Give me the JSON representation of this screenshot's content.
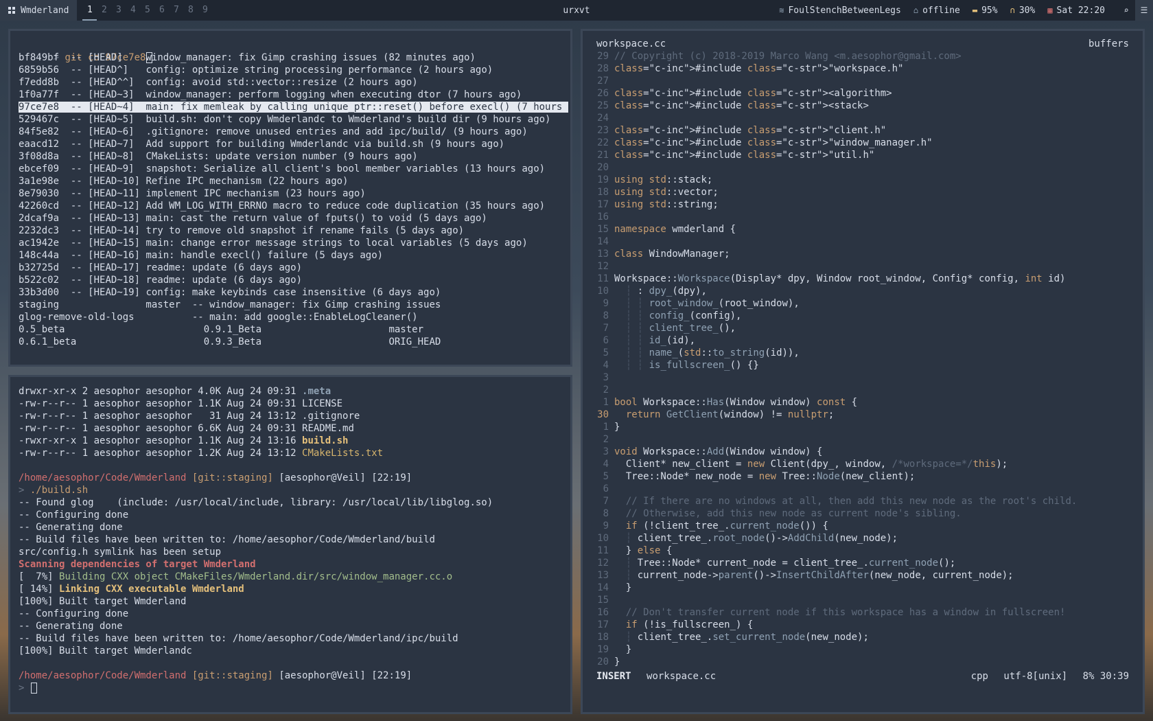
{
  "topbar": {
    "app_label": "Wmderland",
    "workspaces": [
      "1",
      "2",
      "3",
      "4",
      "5",
      "6",
      "7",
      "8",
      "9"
    ],
    "active_workspace": "1",
    "window_title": "urxvt",
    "wifi": "FoulStenchBetweenLegs",
    "network_status": "offline",
    "battery": "95%",
    "volume": "30%",
    "datetime": "Sat 22:20"
  },
  "git_log": {
    "command": "git co 97ce7e8",
    "prompt_symbol": ">",
    "entries": [
      {
        "hash": "bf849bf",
        "ref": "[HEAD]   ",
        "msg": "window_manager: fix Gimp crashing issues (82 minutes ago)"
      },
      {
        "hash": "6859b56",
        "ref": "[HEAD^]  ",
        "msg": "config: optimize string processing performance (2 hours ago)"
      },
      {
        "hash": "f7edd8b",
        "ref": "[HEAD^^] ",
        "msg": "config: avoid std::vector::resize (2 hours ago)"
      },
      {
        "hash": "1f0a77f",
        "ref": "[HEAD~3] ",
        "msg": "window_manager: perform logging when executing dtor (7 hours ago)"
      },
      {
        "hash": "97ce7e8",
        "ref": "[HEAD~4] ",
        "msg": "main: fix memleak by calling unique_ptr::reset() before execl() (7 hours "
      },
      {
        "hash": "529467c",
        "ref": "[HEAD~5] ",
        "msg": "build.sh: don't copy Wmderlandc to Wmderland's build dir (9 hours ago)"
      },
      {
        "hash": "84f5e82",
        "ref": "[HEAD~6] ",
        "msg": ".gitignore: remove unused entries and add ipc/build/ (9 hours ago)"
      },
      {
        "hash": "eaacd12",
        "ref": "[HEAD~7] ",
        "msg": "Add support for building Wmderlandc via build.sh (9 hours ago)"
      },
      {
        "hash": "3f08d8a",
        "ref": "[HEAD~8] ",
        "msg": "CMakeLists: update version number (9 hours ago)"
      },
      {
        "hash": "ebcef09",
        "ref": "[HEAD~9] ",
        "msg": "snapshot: Serialize all client's bool member variables (13 hours ago)"
      },
      {
        "hash": "3a1e98e",
        "ref": "[HEAD~10]",
        "msg": "Refine IPC mechanism (22 hours ago)"
      },
      {
        "hash": "8e79030",
        "ref": "[HEAD~11]",
        "msg": "implement IPC mechanism (23 hours ago)"
      },
      {
        "hash": "42260cd",
        "ref": "[HEAD~12]",
        "msg": "Add WM_LOG_WITH_ERRNO macro to reduce code duplication (35 hours ago)"
      },
      {
        "hash": "2dcaf9a",
        "ref": "[HEAD~13]",
        "msg": "main: cast the return value of fputs() to void (5 days ago)"
      },
      {
        "hash": "2232dc3",
        "ref": "[HEAD~14]",
        "msg": "try to remove old snapshot if rename fails (5 days ago)"
      },
      {
        "hash": "ac1942e",
        "ref": "[HEAD~15]",
        "msg": "main: change error message strings to local variables (5 days ago)"
      },
      {
        "hash": "148c44a",
        "ref": "[HEAD~16]",
        "msg": "main: handle execl() failure (5 days ago)"
      },
      {
        "hash": "b32725d",
        "ref": "[HEAD~17]",
        "msg": "readme: update (6 days ago)"
      },
      {
        "hash": "b522c02",
        "ref": "[HEAD~18]",
        "msg": "readme: update (6 days ago)"
      },
      {
        "hash": "33b3d00",
        "ref": "[HEAD~19]",
        "msg": "config: make keybinds case insensitive (6 days ago)"
      }
    ],
    "selected_index": 4,
    "branches": [
      "staging               master  -- window_manager: fix Gimp crashing issues",
      "glog-remove-old-logs          -- main: add google::EnableLogCleaner()",
      "0.5_beta                        0.9.1_Beta                      master",
      "0.6.1_beta                      0.9.3_Beta                      ORIG_HEAD"
    ]
  },
  "shell": {
    "listing": [
      {
        "perm": "drwxr-xr-x 2 aesophor aesophor 4.0K Aug 24 09:31 ",
        "name": ".meta",
        "style": "dir"
      },
      {
        "perm": "-rw-r--r-- 1 aesophor aesophor 1.1K Aug 24 09:31 ",
        "name": "LICENSE",
        "style": "plain"
      },
      {
        "perm": "-rw-r--r-- 1 aesophor aesophor   31 Aug 24 13:12 ",
        "name": ".gitignore",
        "style": "plain"
      },
      {
        "perm": "-rw-r--r-- 1 aesophor aesophor 6.6K Aug 24 09:31 ",
        "name": "README.md",
        "style": "plain"
      },
      {
        "perm": "-rwxr-xr-x 1 aesophor aesophor 1.1K Aug 24 13:16 ",
        "name": "build.sh",
        "style": "exec"
      },
      {
        "perm": "-rw-r--r-- 1 aesophor aesophor 1.2K Aug 24 13:12 ",
        "name": "CMakeLists.txt",
        "style": "cmake"
      }
    ],
    "prompt_path": "/home/aesophor/Code/Wmderland",
    "prompt_git": "[git::staging]",
    "prompt_user": "[aesophor@Veil]",
    "prompt_time_1": "[22:19]",
    "prompt_time_2": "[22:19]",
    "command": "./build.sh",
    "prompt_symbol": ">",
    "output": [
      {
        "text": "-- Found glog    (include: /usr/local/include, library: /usr/local/lib/libglog.so)",
        "style": "plain"
      },
      {
        "text": "-- Configuring done",
        "style": "plain"
      },
      {
        "text": "-- Generating done",
        "style": "plain"
      },
      {
        "text": "-- Build files have been written to: /home/aesophor/Code/Wmderland/build",
        "style": "plain"
      },
      {
        "text": "src/config.h symlink has been setup",
        "style": "plain"
      },
      {
        "text": "Scanning dependencies of target Wmderland",
        "style": "scan"
      },
      {
        "prefix": "[  7%] ",
        "text": "Building CXX object CMakeFiles/Wmderland.dir/src/window_manager.cc.o",
        "style": "build"
      },
      {
        "prefix": "[ 14%] ",
        "text": "Linking CXX executable Wmderland",
        "style": "link"
      },
      {
        "text": "[100%] Built target Wmderland",
        "style": "plain"
      },
      {
        "text": "-- Configuring done",
        "style": "plain"
      },
      {
        "text": "-- Generating done",
        "style": "plain"
      },
      {
        "text": "-- Build files have been written to: /home/aesophor/Code/Wmderland/ipc/build",
        "style": "plain"
      },
      {
        "text": "[100%] Built target Wmderlandc",
        "style": "plain"
      }
    ]
  },
  "editor": {
    "filename": "workspace.cc",
    "buffers_label": "buffers",
    "lines": [
      {
        "n": "29",
        "code": "// Copyright (c) 2018-2019 Marco Wang <m.aesophor@gmail.com>",
        "style": "cmt"
      },
      {
        "n": "28",
        "code": "#include \"workspace.h\"",
        "style": "inc"
      },
      {
        "n": "27",
        "code": "",
        "style": "plain"
      },
      {
        "n": "26",
        "code": "#include <algorithm>",
        "style": "inc"
      },
      {
        "n": "25",
        "code": "#include <stack>",
        "style": "inc"
      },
      {
        "n": "24",
        "code": "",
        "style": "plain"
      },
      {
        "n": "23",
        "code": "#include \"client.h\"",
        "style": "inc"
      },
      {
        "n": "22",
        "code": "#include \"window_manager.h\"",
        "style": "inc"
      },
      {
        "n": "21",
        "code": "#include \"util.h\"",
        "style": "inc"
      },
      {
        "n": "20",
        "code": "",
        "style": "plain"
      },
      {
        "n": "19",
        "code": "using std::stack;",
        "style": "using"
      },
      {
        "n": "18",
        "code": "using std::vector;",
        "style": "using"
      },
      {
        "n": "17",
        "code": "using std::string;",
        "style": "using"
      },
      {
        "n": "16",
        "code": "",
        "style": "plain"
      },
      {
        "n": "15",
        "code": "namespace wmderland {",
        "style": "ns"
      },
      {
        "n": "14",
        "code": "",
        "style": "plain"
      },
      {
        "n": "13",
        "code": "class WindowManager;",
        "style": "class"
      },
      {
        "n": "12",
        "code": "",
        "style": "plain"
      },
      {
        "n": "11",
        "code": "Workspace::Workspace(Display* dpy, Window root_window, Config* config, int id)",
        "style": "ctor"
      },
      {
        "n": "10",
        "code": "  ┆ : dpy_(dpy),",
        "style": "init"
      },
      {
        "n": "9",
        "code": "  ┆ ┆ root_window_(root_window),",
        "style": "init"
      },
      {
        "n": "8",
        "code": "  ┆ ┆ config_(config),",
        "style": "init"
      },
      {
        "n": "7",
        "code": "  ┆ ┆ client_tree_(),",
        "style": "init"
      },
      {
        "n": "6",
        "code": "  ┆ ┆ id_(id),",
        "style": "init"
      },
      {
        "n": "5",
        "code": "  ┆ ┆ name_(std::to_string(id)),",
        "style": "init"
      },
      {
        "n": "4",
        "code": "  ┆ ┆ is_fullscreen_() {}",
        "style": "init"
      },
      {
        "n": "3",
        "code": "",
        "style": "plain"
      },
      {
        "n": "2",
        "code": "",
        "style": "plain"
      },
      {
        "n": "1",
        "code": "bool Workspace::Has(Window window) const {",
        "style": "fnbool"
      },
      {
        "n": "30",
        "code": "  return GetClient(window) != nullptr;",
        "style": "ret",
        "current": true
      },
      {
        "n": "1",
        "code": "}",
        "style": "plain"
      },
      {
        "n": "2",
        "code": "",
        "style": "plain"
      },
      {
        "n": "3",
        "code": "void Workspace::Add(Window window) {",
        "style": "fnvoid"
      },
      {
        "n": "4",
        "code": "  Client* new_client = new Client(dpy_, window, /*workspace=*/this);",
        "style": "newc"
      },
      {
        "n": "5",
        "code": "  Tree::Node* new_node = new Tree::Node(new_client);",
        "style": "newn"
      },
      {
        "n": "6",
        "code": "",
        "style": "plain"
      },
      {
        "n": "7",
        "code": "  // If there are no windows at all, then add this new node as the root's child.",
        "style": "cmt"
      },
      {
        "n": "8",
        "code": "  // Otherwise, add this new node as current node's sibling.",
        "style": "cmt"
      },
      {
        "n": "9",
        "code": "  if (!client_tree_.current_node()) {",
        "style": "if1"
      },
      {
        "n": "10",
        "code": "  ┆ client_tree_.root_node()->AddChild(new_node);",
        "style": "stmt1"
      },
      {
        "n": "11",
        "code": "  } else {",
        "style": "else"
      },
      {
        "n": "12",
        "code": "  ┆ Tree::Node* current_node = client_tree_.current_node();",
        "style": "stmt2"
      },
      {
        "n": "13",
        "code": "  ┆ current_node->parent()->InsertChildAfter(new_node, current_node);",
        "style": "stmt3"
      },
      {
        "n": "14",
        "code": "  }",
        "style": "plain"
      },
      {
        "n": "15",
        "code": "",
        "style": "plain"
      },
      {
        "n": "16",
        "code": "  // Don't transfer current node if this workspace has a window in fullscreen!",
        "style": "cmt"
      },
      {
        "n": "17",
        "code": "  if (!is_fullscreen_) {",
        "style": "if2"
      },
      {
        "n": "18",
        "code": "  ┆ client_tree_.set_current_node(new_node);",
        "style": "stmt4"
      },
      {
        "n": "19",
        "code": "  }",
        "style": "plain"
      },
      {
        "n": "20",
        "code": "}",
        "style": "plain"
      }
    ],
    "status": {
      "mode": "INSERT",
      "file": "workspace.cc",
      "filetype": "cpp",
      "encoding": "utf-8[unix]",
      "position": "8% 30:39"
    }
  },
  "colors": {
    "bar_bg": "#1f2631",
    "pane_bg": "#2b3442",
    "pane_border": "#3c4757",
    "keyword": "#c99e71",
    "string": "#a3be8c",
    "function": "#8fa1b3",
    "comment": "#5f6b7c",
    "path_red": "#d26f6f"
  }
}
